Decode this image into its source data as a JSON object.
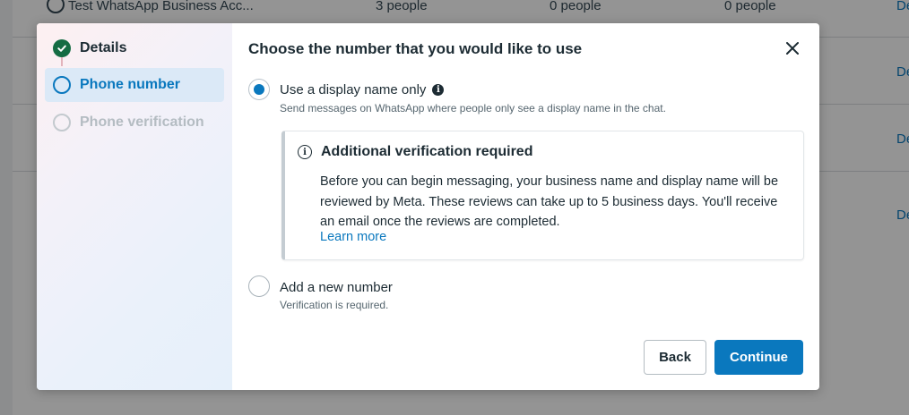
{
  "background": {
    "row0": {
      "name": "Test WhatsApp Business Acc...",
      "col2": "3 people",
      "col3": "0 people",
      "col4": "0 people"
    },
    "link_text": "De"
  },
  "dialog": {
    "steps": [
      {
        "label": "Details",
        "state": "complete"
      },
      {
        "label": "Phone number",
        "state": "active"
      },
      {
        "label": "Phone verification",
        "state": "pending"
      }
    ],
    "title": "Choose the number that you would like to use",
    "options": {
      "display_name": {
        "label": "Use a display name only",
        "description": "Send messages on WhatsApp where people only see a display name in the chat.",
        "selected": true
      },
      "new_number": {
        "label": "Add a new number",
        "description": "Verification is required.",
        "selected": false
      }
    },
    "callout": {
      "title": "Additional verification required",
      "body": "Before you can begin messaging, your business name and display name will be reviewed by Meta. These reviews can take up to 5 business days. You'll receive an email once the reviews are completed.",
      "link": "Learn more"
    },
    "buttons": {
      "back": "Back",
      "continue": "Continue"
    }
  },
  "colors": {
    "accent": "#0a78be",
    "success": "#146c43",
    "text": "#1c2b33"
  },
  "icons": {
    "close": "close-icon",
    "info": "info-icon",
    "check": "check-icon",
    "whatsapp": "whatsapp-icon"
  }
}
